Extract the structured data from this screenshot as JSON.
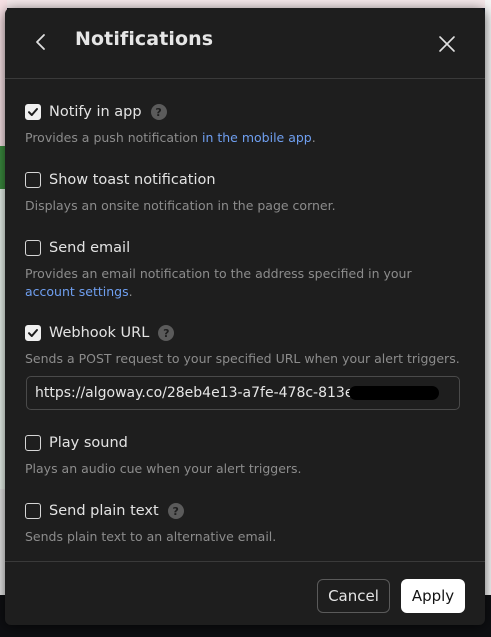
{
  "dialog": {
    "title": "Notifications"
  },
  "options": [
    {
      "label": "Notify in app",
      "checked": true,
      "has_help": true,
      "desc_before": "Provides a push notification ",
      "desc_link": "in the mobile app",
      "desc_after": "."
    },
    {
      "label": "Show toast notification",
      "checked": false,
      "has_help": false,
      "desc": "Displays an onsite notification in the page corner."
    },
    {
      "label": "Send email",
      "checked": false,
      "has_help": false,
      "desc_before": "Provides an email notification to the address specified in your ",
      "desc_link": "account settings",
      "desc_after": "."
    },
    {
      "label": "Webhook URL",
      "checked": true,
      "has_help": true,
      "desc": "Sends a POST request to your specified URL when your alert triggers.",
      "input_value": "https://algoway.co/28eb4e13-a7fe-478c-813e-"
    },
    {
      "label": "Play sound",
      "checked": false,
      "has_help": false,
      "desc": "Plays an audio cue when your alert triggers."
    },
    {
      "label": "Send plain text",
      "checked": false,
      "has_help": true,
      "desc": "Sends plain text to an alternative email."
    }
  ],
  "footer": {
    "cancel_label": "Cancel",
    "apply_label": "Apply"
  },
  "icons": {
    "help_glyph": "?"
  },
  "colors": {
    "link": "#6f9ff0",
    "modal_bg": "#1e1e1e",
    "apply_bg": "#ffffff"
  }
}
